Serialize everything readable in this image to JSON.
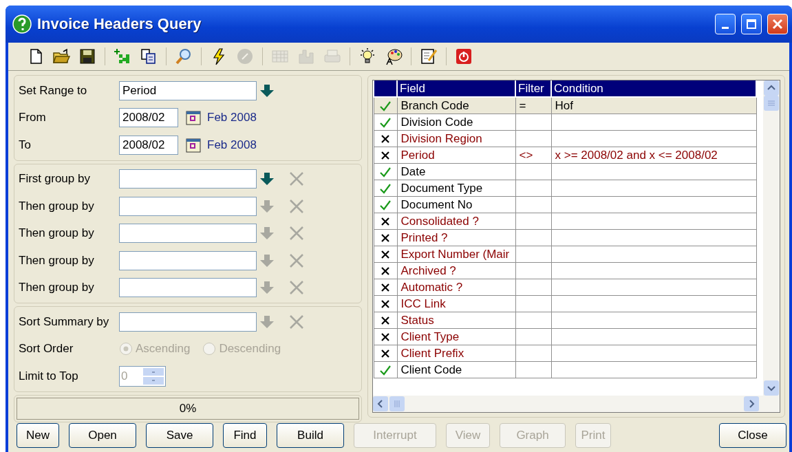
{
  "window": {
    "title": "Invoice Headers Query"
  },
  "toolbar_groups": [
    [
      {
        "kind": "new",
        "disabled": false
      },
      {
        "kind": "open",
        "disabled": false
      },
      {
        "kind": "save",
        "disabled": false
      }
    ],
    [
      {
        "kind": "add-grid",
        "disabled": false
      },
      {
        "kind": "copy",
        "disabled": false
      }
    ],
    [
      {
        "kind": "search",
        "disabled": false
      }
    ],
    [
      {
        "kind": "lightning",
        "disabled": false
      },
      {
        "kind": "stop",
        "disabled": true
      }
    ],
    [
      {
        "kind": "table",
        "disabled": true
      },
      {
        "kind": "chart",
        "disabled": true
      },
      {
        "kind": "print",
        "disabled": true
      }
    ],
    [
      {
        "kind": "bulb",
        "disabled": false
      },
      {
        "kind": "palette",
        "disabled": false
      }
    ],
    [
      {
        "kind": "notepad",
        "disabled": false
      }
    ],
    [
      {
        "kind": "power",
        "disabled": false
      }
    ]
  ],
  "range": {
    "label": "Set Range to",
    "value": "Period"
  },
  "dates": [
    {
      "label": "From",
      "value": "2008/02",
      "display": "Feb 2008"
    },
    {
      "label": "To",
      "value": "2008/02",
      "display": "Feb 2008"
    }
  ],
  "grouping": [
    {
      "label": "First group by",
      "disabled": false
    },
    {
      "label": "Then group by",
      "disabled": true
    },
    {
      "label": "Then group by",
      "disabled": true
    },
    {
      "label": "Then group by",
      "disabled": true
    },
    {
      "label": "Then group by",
      "disabled": true
    }
  ],
  "sort": {
    "label": "Sort Summary by",
    "disabled": true
  },
  "sort_order": {
    "label": "Sort Order",
    "options": [
      {
        "label": "Ascending",
        "selected": true,
        "disabled": true
      },
      {
        "label": "Descending",
        "selected": false,
        "disabled": true
      }
    ]
  },
  "limit": {
    "label": "Limit to Top",
    "value": "0",
    "disabled": true
  },
  "progress": {
    "text": "0%",
    "level": 0
  },
  "grid": {
    "columns": [
      "Field",
      "Filter",
      "Condition"
    ],
    "rows": [
      {
        "included": true,
        "field": "Branch Code",
        "filter": "=",
        "condition": "Hof",
        "selected": true
      },
      {
        "included": true,
        "field": "Division Code",
        "selected": false
      },
      {
        "included": false,
        "field": "Division Region",
        "selected": false
      },
      {
        "included": false,
        "field": "Period",
        "filter": "<>",
        "condition": "x >= 2008/02 and x <= 2008/02",
        "selected": false
      },
      {
        "included": true,
        "field": "Date",
        "selected": false
      },
      {
        "included": true,
        "field": "Document Type",
        "selected": false
      },
      {
        "included": true,
        "field": "Document No",
        "selected": false
      },
      {
        "included": false,
        "field": "Consolidated ?",
        "selected": false
      },
      {
        "included": false,
        "field": "Printed ?",
        "selected": false
      },
      {
        "included": false,
        "field": "Export Number (Mair",
        "selected": false
      },
      {
        "included": false,
        "field": "Archived ?",
        "selected": false
      },
      {
        "included": false,
        "field": "Automatic ?",
        "selected": false
      },
      {
        "included": false,
        "field": "ICC Link",
        "selected": false
      },
      {
        "included": false,
        "field": "Status",
        "selected": false
      },
      {
        "included": false,
        "field": "Client Type",
        "selected": false
      },
      {
        "included": false,
        "field": "Client Prefix",
        "selected": false
      },
      {
        "included": true,
        "field": "Client Code",
        "selected": false
      }
    ]
  },
  "buttons": [
    {
      "label": "New",
      "disabled": false
    },
    {
      "label": "Open",
      "disabled": false
    },
    {
      "label": "Save",
      "disabled": false
    },
    {
      "label": "Find",
      "disabled": false
    },
    {
      "label": "Build",
      "disabled": false
    },
    {
      "label": "Interrupt",
      "disabled": true
    },
    {
      "label": "View",
      "disabled": true
    },
    {
      "label": "Graph",
      "disabled": true
    },
    {
      "label": "Print",
      "disabled": true
    },
    {
      "label": "Close",
      "disabled": false
    }
  ]
}
